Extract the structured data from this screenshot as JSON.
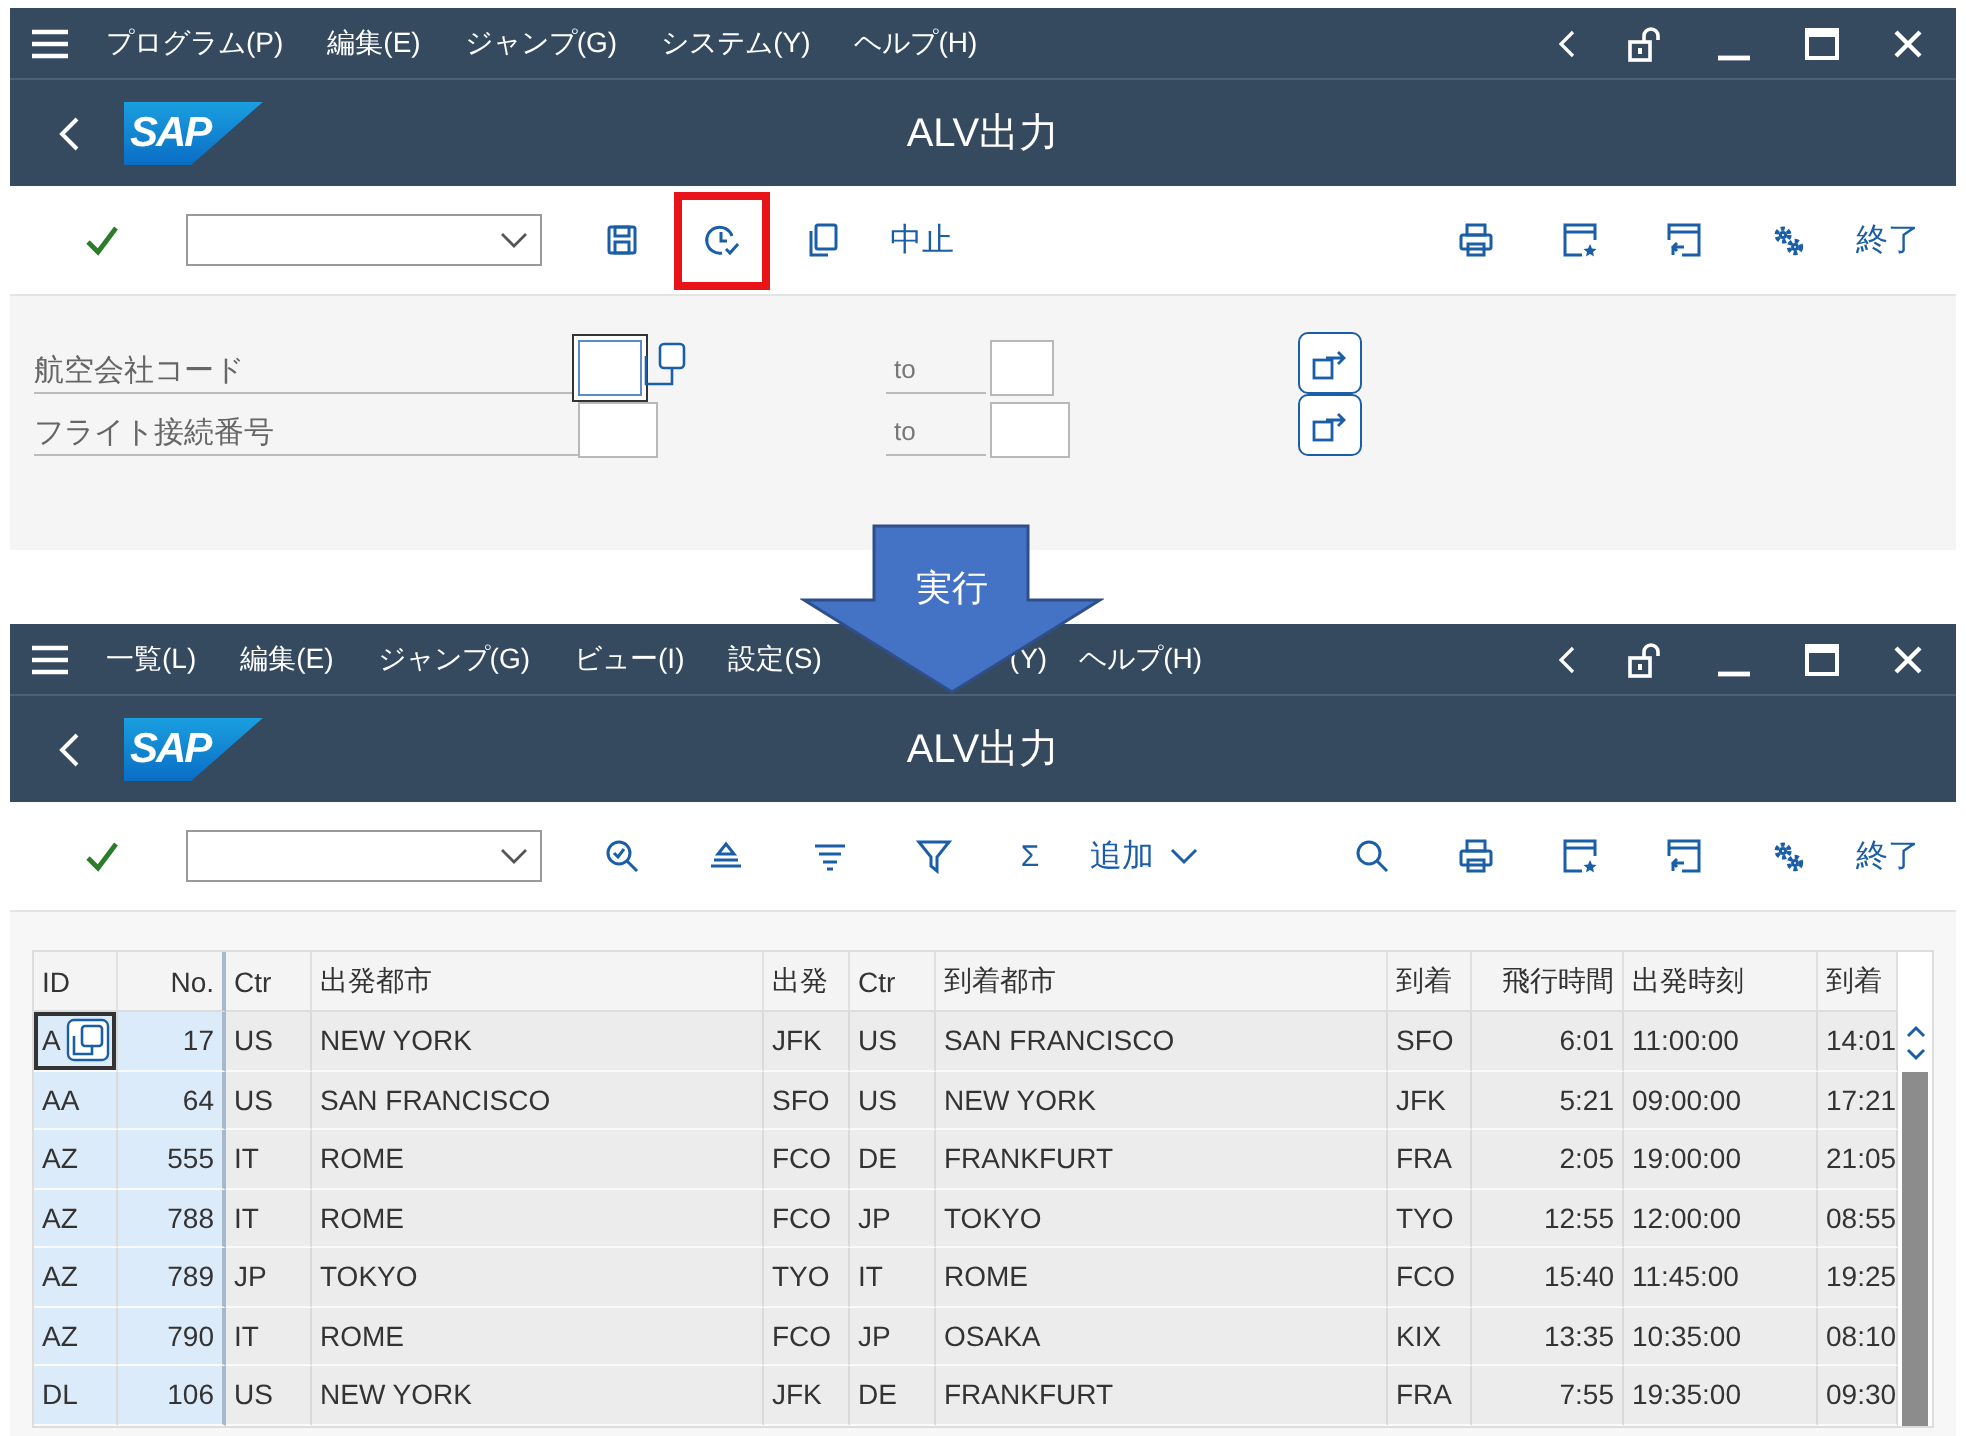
{
  "windows": [
    {
      "kind": "selection",
      "menu": [
        "プログラム(P)",
        "編集(E)",
        "ジャンプ(G)",
        "システム(Y)",
        "ヘルプ(H)"
      ],
      "logo": "SAP",
      "title": "ALV出力",
      "toolbar_left": [
        {
          "kind": "check",
          "highlighted": false
        },
        {
          "kind": "command-field",
          "highlighted": false
        },
        {
          "kind": "save",
          "highlighted": false
        },
        {
          "kind": "clock",
          "highlighted": true
        },
        {
          "kind": "copy",
          "highlighted": false
        },
        {
          "kind": "text",
          "label": "中止",
          "highlighted": false
        }
      ],
      "toolbar_right": [
        {
          "kind": "print"
        },
        {
          "kind": "window-star"
        },
        {
          "kind": "window-back"
        },
        {
          "kind": "settings"
        },
        {
          "kind": "text",
          "label": "終了"
        }
      ],
      "fields": [
        {
          "label": "航空会社コード",
          "to_label": "to",
          "focused": true
        },
        {
          "label": "フライト接続番号",
          "to_label": "to",
          "focused": false
        }
      ]
    },
    {
      "kind": "list",
      "menu": [
        "一覧(L)",
        "編集(E)",
        "ジャンプ(G)",
        "ビュー(I)",
        "設定(S)",
        {
          "label": "(Y)",
          "covered": true
        },
        "ヘルプ(H)"
      ],
      "logo": "SAP",
      "title": "ALV出力",
      "toolbar_left": [
        {
          "kind": "check",
          "highlighted": false
        },
        {
          "kind": "command-field",
          "highlighted": false
        },
        {
          "kind": "zoom",
          "highlighted": false
        },
        {
          "kind": "sort-up",
          "highlighted": false
        },
        {
          "kind": "sort-down",
          "highlighted": false
        },
        {
          "kind": "filter",
          "highlighted": false
        },
        {
          "kind": "glyph",
          "label": "Σ",
          "highlighted": false
        },
        {
          "kind": "menu-text",
          "label": "追加",
          "highlighted": false
        }
      ],
      "toolbar_right": [
        {
          "kind": "search"
        },
        {
          "kind": "print"
        },
        {
          "kind": "window-star"
        },
        {
          "kind": "window-back"
        },
        {
          "kind": "settings"
        },
        {
          "kind": "text",
          "label": "終了"
        }
      ],
      "table": {
        "columns": [
          {
            "label": "ID",
            "key": true,
            "numeric": false
          },
          {
            "label": "No.",
            "key": true,
            "numeric": true
          },
          {
            "label": "Ctr",
            "key": false,
            "numeric": false
          },
          {
            "label": "出発都市",
            "key": false,
            "numeric": false
          },
          {
            "label": "出発",
            "key": false,
            "numeric": false
          },
          {
            "label": "Ctr",
            "key": false,
            "numeric": false
          },
          {
            "label": "到着都市",
            "key": false,
            "numeric": false
          },
          {
            "label": "到着",
            "key": false,
            "numeric": false
          },
          {
            "label": "飛行時間",
            "key": false,
            "numeric": true
          },
          {
            "label": "出発時刻",
            "key": false,
            "numeric": false
          },
          {
            "label": "到着",
            "key": false,
            "numeric": false
          }
        ],
        "rows": [
          {
            "focused": true,
            "cells": [
              "A",
              "17",
              "US",
              "NEW YORK",
              "JFK",
              "US",
              "SAN FRANCISCO",
              "SFO",
              "6:01",
              "11:00:00",
              "14:01"
            ]
          },
          {
            "focused": false,
            "cells": [
              "AA",
              "64",
              "US",
              "SAN FRANCISCO",
              "SFO",
              "US",
              "NEW YORK",
              "JFK",
              "5:21",
              "09:00:00",
              "17:21"
            ]
          },
          {
            "focused": false,
            "cells": [
              "AZ",
              "555",
              "IT",
              "ROME",
              "FCO",
              "DE",
              "FRANKFURT",
              "FRA",
              "2:05",
              "19:00:00",
              "21:05"
            ]
          },
          {
            "focused": false,
            "cells": [
              "AZ",
              "788",
              "IT",
              "ROME",
              "FCO",
              "JP",
              "TOKYO",
              "TYO",
              "12:55",
              "12:00:00",
              "08:55"
            ]
          },
          {
            "focused": false,
            "cells": [
              "AZ",
              "789",
              "JP",
              "TOKYO",
              "TYO",
              "IT",
              "ROME",
              "FCO",
              "15:40",
              "11:45:00",
              "19:25"
            ]
          },
          {
            "focused": false,
            "cells": [
              "AZ",
              "790",
              "IT",
              "ROME",
              "FCO",
              "JP",
              "OSAKA",
              "KIX",
              "13:35",
              "10:35:00",
              "08:10"
            ]
          },
          {
            "focused": false,
            "cells": [
              "DL",
              "106",
              "US",
              "NEW YORK",
              "JFK",
              "DE",
              "FRANKFURT",
              "FRA",
              "7:55",
              "19:35:00",
              "09:30"
            ]
          }
        ]
      }
    }
  ],
  "arrow": {
    "label": "実行"
  }
}
